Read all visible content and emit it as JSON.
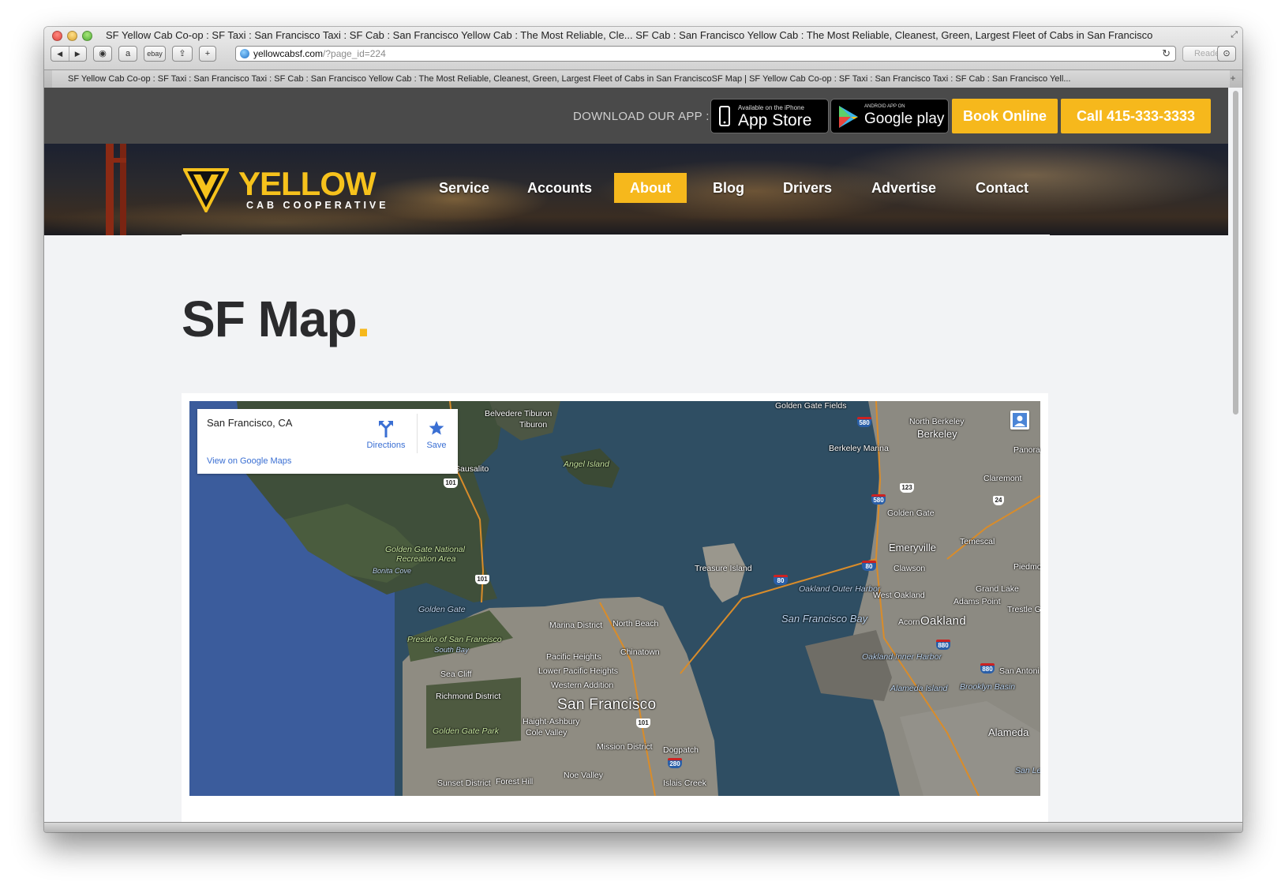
{
  "browser": {
    "window_title": "SF Yellow Cab Co-op : SF Taxi : San Francisco Taxi : SF Cab : San Francisco Yellow Cab : The Most Reliable, Cle... SF Cab : San Francisco Yellow Cab : The Most Reliable, Cleanest, Green, Largest Fleet of Cabs in San Francisco",
    "url_host": "yellowcabsf.com",
    "url_path": "/?page_id=224",
    "reader_label": "Reader",
    "bookmark_ebay": "ebay",
    "tab_title": "SF Yellow Cab Co-op : SF Taxi : San Francisco Taxi : SF Cab : San Francisco Yellow Cab : The Most Reliable, Cleanest, Green, Largest Fleet of Cabs in San FranciscoSF Map | SF Yellow Cab Co-op : SF Taxi : San Francisco Taxi : SF Cab : San Francisco Yell..."
  },
  "topbar": {
    "download_label": "DOWNLOAD OUR APP :",
    "appstore_small": "Available on the iPhone",
    "appstore_big": "App Store",
    "gplay_small": "ANDROID APP ON",
    "gplay_big": "Google play",
    "book_label": "Book Online",
    "call_label": "Call 415-333-3333"
  },
  "logo": {
    "word": "YELLOW",
    "sub": "CAB COOPERATIVE"
  },
  "nav": {
    "items": [
      "Service",
      "Accounts",
      "About",
      "Blog",
      "Drivers",
      "Advertise",
      "Contact"
    ],
    "active": "About"
  },
  "page": {
    "title": "SF Map",
    "title_dot": "."
  },
  "map": {
    "info_place": "San Francisco, CA",
    "info_link": "View on Google Maps",
    "directions_label": "Directions",
    "save_label": "Save",
    "labels": {
      "belvedere": "Belvedere Tiburon",
      "tiburon": "Tiburon",
      "angel": "Angel Island",
      "sausalito": "Sausalito",
      "ggnra1": "Golden Gate National",
      "ggnra2": "Recreation Area",
      "bonita": "Bonita Cove",
      "golden_gate": "Golden Gate",
      "presidio": "Presidio of San Francisco",
      "south_bay": "South Bay",
      "sea_cliff": "Sea Cliff",
      "richmond": "Richmond District",
      "gg_park": "Golden Gate Park",
      "sunset": "Sunset District",
      "forest_hill": "Forest Hill",
      "marina": "Marina District",
      "north_beach": "North Beach",
      "chinatown": "Chinatown",
      "pacific_heights": "Pacific Heights",
      "lower_pacific": "Lower Pacific Heights",
      "western_addition": "Western Addition",
      "haight": "Haight-Ashbury",
      "cole_valley": "Cole Valley",
      "mission": "Mission District",
      "noe_valley": "Noe Valley",
      "dogpatch": "Dogpatch",
      "islais": "Islais Creek",
      "san_francisco": "San Francisco",
      "treasure": "Treasure Island",
      "oakland_outer": "Oakland Outer Harbor",
      "sf_bay": "San Francisco Bay",
      "oakland_inner": "Oakland Inner Harbor",
      "alameda_island": "Alameda Island",
      "brooklyn": "Brooklyn Basin",
      "alameda": "Alameda",
      "oakland": "Oakland",
      "acorn": "Acorn",
      "west_oakland": "West Oakland",
      "clawson": "Clawson",
      "emeryville": "Emeryville",
      "golden_gate_e": "Golden Gate",
      "berkeley_marina": "Berkeley Marina",
      "berkeley": "Berkeley",
      "north_berkeley": "North Berkeley",
      "gg_fields": "Golden Gate Fields",
      "panoramic": "Panoramic",
      "claremont": "Claremont",
      "temescal": "Temescal",
      "piedmont": "Piedmo",
      "grand_lake": "Grand Lake",
      "adams_point": "Adams Point",
      "trestle": "Trestle Gl",
      "san_antonio": "San Antoni",
      "san_le": "San Le"
    },
    "shields": {
      "s101a": "101",
      "s101b": "101",
      "s101c": "101",
      "s280": "280",
      "s80a": "80",
      "s80b": "80",
      "s580a": "580",
      "s580b": "580",
      "s880a": "880",
      "s880b": "880",
      "s123": "123",
      "s24": "24"
    }
  }
}
